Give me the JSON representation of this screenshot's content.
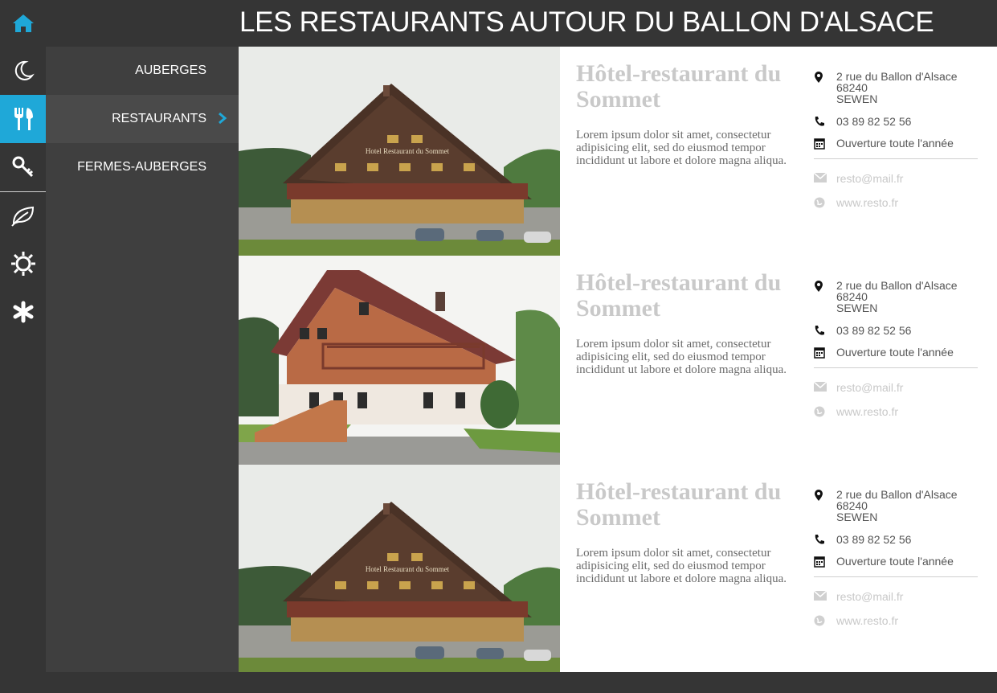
{
  "header": {
    "title": "LES RESTAURANTS AUTOUR DU BALLON D'ALSACE"
  },
  "iconbar": {
    "icons": [
      "home-icon",
      "moon-icon",
      "cutlery-icon",
      "key-icon",
      "leaf-icon",
      "sun-icon",
      "asterisk-icon"
    ],
    "active": "cutlery-icon",
    "accent_color": "#1fa8d8"
  },
  "submenu": {
    "items": [
      {
        "label": "AUBERGES"
      },
      {
        "label": "RESTAURANTS"
      },
      {
        "label": "FERMES-AUBERGES"
      }
    ],
    "active": "RESTAURANTS"
  },
  "cards": [
    {
      "title": "Hôtel-restaurant du Sommet",
      "description": "Lorem ipsum dolor sit amet, consectetur adipisicing elit, sed do eiusmod tempor incididunt ut labore et dolore magna aliqua.",
      "address_line1": "2 rue du Ballon d'Alsace",
      "address_line2": "68240",
      "address_line3": "SEWEN",
      "phone": "03 89 82 52 56",
      "hours": "Ouverture toute l'année",
      "email": "resto@mail.fr",
      "website": "www.resto.fr",
      "photo_sign": "Hotel Restaurant du Sommet"
    },
    {
      "title": "Hôtel-restaurant du Sommet",
      "description": "Lorem ipsum dolor sit amet, consectetur adipisicing elit, sed do eiusmod tempor incididunt ut labore et dolore magna aliqua.",
      "address_line1": "2 rue du Ballon d'Alsace",
      "address_line2": "68240",
      "address_line3": "SEWEN",
      "phone": "03 89 82 52 56",
      "hours": "Ouverture toute l'année",
      "email": "resto@mail.fr",
      "website": "www.resto.fr"
    },
    {
      "title": "Hôtel-restaurant du Sommet",
      "description": "Lorem ipsum dolor sit amet, consectetur adipisicing elit, sed do eiusmod tempor incididunt ut labore et dolore magna aliqua.",
      "address_line1": "2 rue du Ballon d'Alsace",
      "address_line2": "68240",
      "address_line3": "SEWEN",
      "phone": "03 89 82 52 56",
      "hours": "Ouverture toute l'année",
      "email": "resto@mail.fr",
      "website": "www.resto.fr",
      "photo_sign": "Hotel Restaurant du Sommet"
    }
  ]
}
